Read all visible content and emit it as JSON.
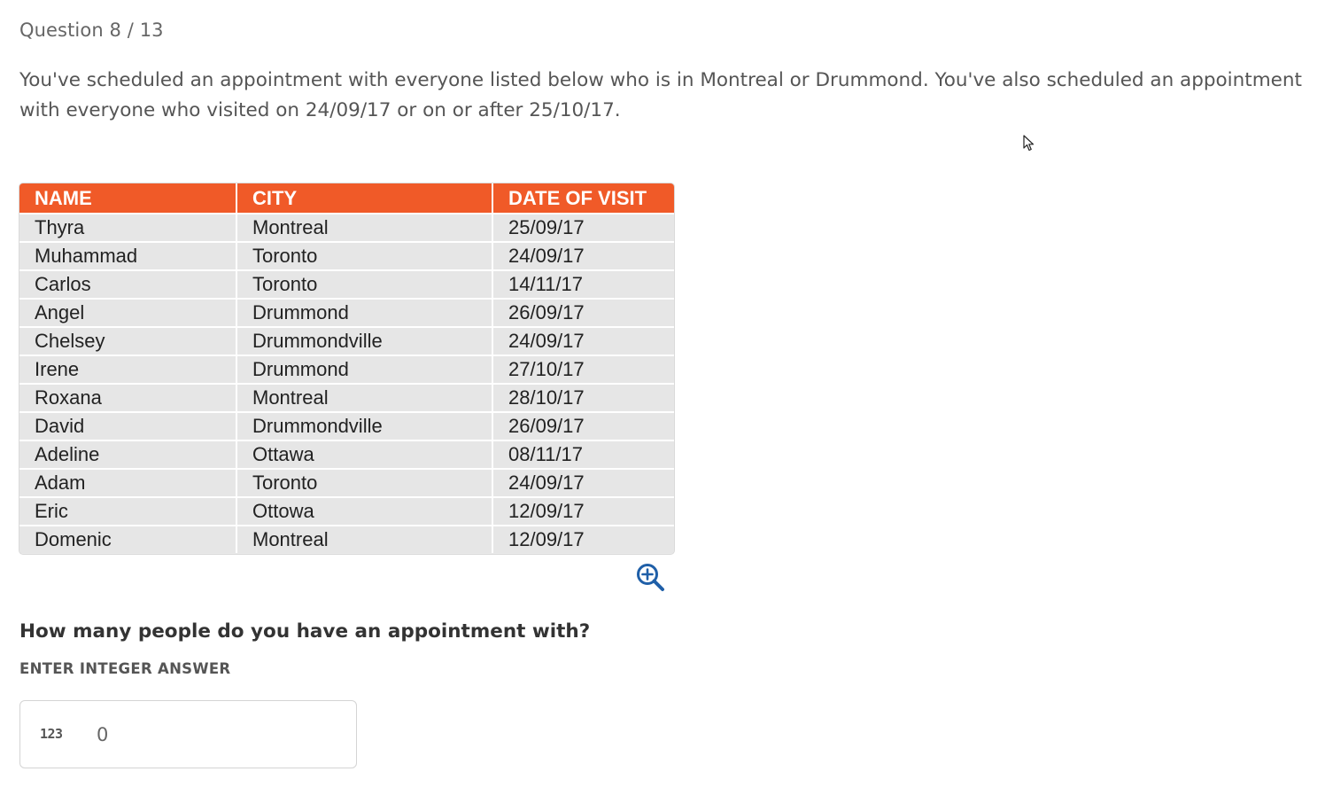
{
  "header": {
    "question_counter": "Question 8 / 13"
  },
  "prompt": {
    "text": "You've scheduled an appointment with everyone listed below who is in Montreal or Drummond. You've also scheduled an appointment with everyone who visited on 24/09/17 or on or after 25/10/17."
  },
  "table": {
    "headers": [
      "NAME",
      "CITY",
      "DATE OF VISIT"
    ],
    "header_color": "#f05a28",
    "rows": [
      [
        "Thyra",
        "Montreal",
        "25/09/17"
      ],
      [
        "Muhammad",
        "Toronto",
        "24/09/17"
      ],
      [
        "Carlos",
        "Toronto",
        "14/11/17"
      ],
      [
        "Angel",
        "Drummond",
        "26/09/17"
      ],
      [
        "Chelsey",
        "Drummondville",
        "24/09/17"
      ],
      [
        "Irene",
        "Drummond",
        "27/10/17"
      ],
      [
        "Roxana",
        "Montreal",
        "28/10/17"
      ],
      [
        "David",
        "Drummondville",
        "26/09/17"
      ],
      [
        "Adeline",
        "Ottawa",
        "08/11/17"
      ],
      [
        "Adam",
        "Toronto",
        "24/09/17"
      ],
      [
        "Eric",
        "Ottowa",
        "12/09/17"
      ],
      [
        "Domenic",
        "Montreal",
        "12/09/17"
      ]
    ]
  },
  "zoom": {
    "icon": "zoom-in-icon",
    "color": "#1f5fa8"
  },
  "question": {
    "text": "How many people do you have an appointment with?",
    "answer_label": "ENTER INTEGER ANSWER",
    "input_icon_text": "123",
    "input_value": "0"
  }
}
